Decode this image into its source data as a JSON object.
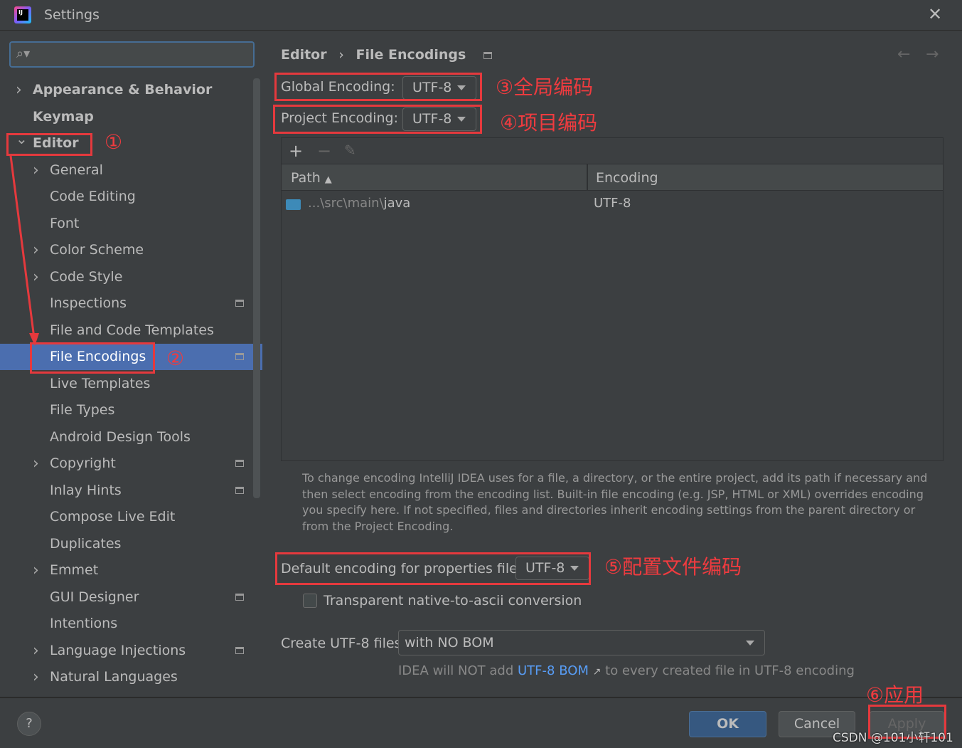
{
  "window": {
    "title": "Settings",
    "icon": "intellij-idea-icon"
  },
  "sidebar": {
    "search_placeholder": "",
    "items": [
      {
        "label": "Appearance & Behavior",
        "level": 0,
        "expandable": true,
        "bold": true
      },
      {
        "label": "Keymap",
        "level": 0,
        "expandable": false,
        "bold": true
      },
      {
        "label": "Editor",
        "level": 0,
        "expandable": true,
        "expanded": true,
        "bold": true
      },
      {
        "label": "General",
        "level": 1,
        "expandable": true
      },
      {
        "label": "Code Editing",
        "level": 1
      },
      {
        "label": "Font",
        "level": 1
      },
      {
        "label": "Color Scheme",
        "level": 1,
        "expandable": true
      },
      {
        "label": "Code Style",
        "level": 1,
        "expandable": true
      },
      {
        "label": "Inspections",
        "level": 1,
        "project_icon": true
      },
      {
        "label": "File and Code Templates",
        "level": 1
      },
      {
        "label": "File Encodings",
        "level": 1,
        "selected": true,
        "project_icon": true
      },
      {
        "label": "Live Templates",
        "level": 1
      },
      {
        "label": "File Types",
        "level": 1
      },
      {
        "label": "Android Design Tools",
        "level": 1
      },
      {
        "label": "Copyright",
        "level": 1,
        "expandable": true,
        "project_icon": true
      },
      {
        "label": "Inlay Hints",
        "level": 1,
        "project_icon": true
      },
      {
        "label": "Compose Live Edit",
        "level": 1
      },
      {
        "label": "Duplicates",
        "level": 1
      },
      {
        "label": "Emmet",
        "level": 1,
        "expandable": true
      },
      {
        "label": "GUI Designer",
        "level": 1,
        "project_icon": true
      },
      {
        "label": "Intentions",
        "level": 1
      },
      {
        "label": "Language Injections",
        "level": 1,
        "expandable": true,
        "project_icon": true
      },
      {
        "label": "Natural Languages",
        "level": 1,
        "expandable": true
      }
    ]
  },
  "breadcrumb": {
    "parent": "Editor",
    "separator": "›",
    "current": "File Encodings"
  },
  "main": {
    "global_label": "Global Encoding:",
    "global_value": "UTF-8",
    "project_label": "Project Encoding:",
    "project_value": "UTF-8",
    "table": {
      "columns": [
        "Path",
        "Encoding"
      ],
      "rows": [
        {
          "path_prefix": "...\\src\\main\\",
          "path_last": "java",
          "encoding": "UTF-8"
        }
      ]
    },
    "help": "To change encoding IntelliJ IDEA uses for a file, a directory, or the entire project, add its path if necessary and then select encoding from the encoding list. Built-in file encoding (e.g. JSP, HTML or XML) overrides encoding you specify here. If not specified, files and directories inherit encoding settings from the parent directory or from the Project Encoding.",
    "props_label": "Default encoding for properties files:",
    "props_value": "UTF-8",
    "transparent_label": "Transparent native-to-ascii conversion",
    "transparent_checked": false,
    "bom_label": "Create UTF-8 files:",
    "bom_value": "with NO BOM",
    "bom_hint_pre": "IDEA will NOT add",
    "bom_hint_link": "UTF-8 BOM",
    "bom_hint_arrow": "↗",
    "bom_hint_post": "to every created file in UTF-8 encoding"
  },
  "footer": {
    "help": "?",
    "ok": "OK",
    "cancel": "Cancel",
    "apply": "Apply"
  },
  "annotations": {
    "a1": "①",
    "a2": "②",
    "a3": "③全局编码",
    "a4": "④项目编码",
    "a5": "⑤配置文件编码",
    "a6": "⑥应用"
  },
  "watermark": "CSDN @101小轩101",
  "colors": {
    "accent": "#4b6eaf",
    "annotation": "#e5393d",
    "link": "#589df6"
  }
}
